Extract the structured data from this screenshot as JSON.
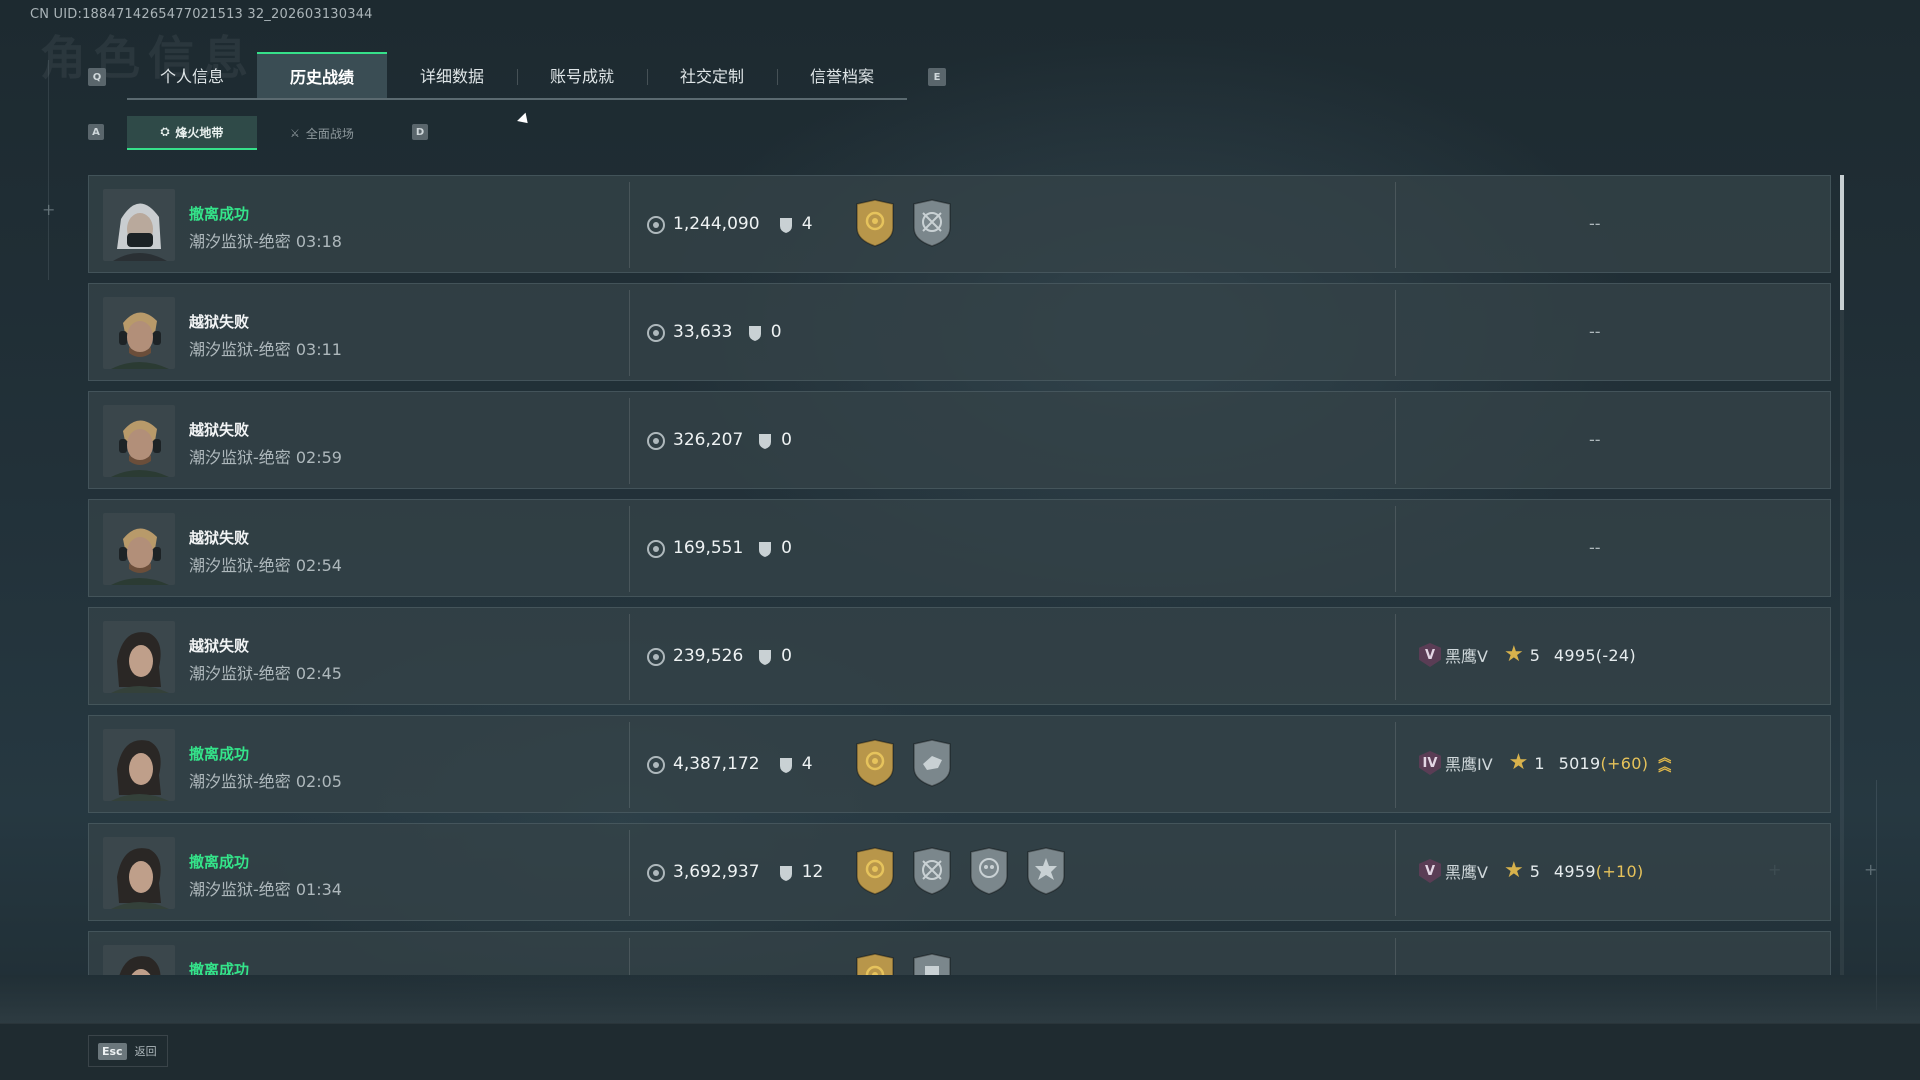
{
  "uid": "CN UID:1884714265477021513 32_202603130344",
  "ghost_title": "角色信息",
  "tabs": {
    "left_key": "Q",
    "right_key": "E",
    "items": [
      {
        "label": "个人信息"
      },
      {
        "label": "历史战绩"
      },
      {
        "label": "详细数据"
      },
      {
        "label": "账号成就"
      },
      {
        "label": "社交定制"
      },
      {
        "label": "信誉档案"
      }
    ],
    "active_index": 1
  },
  "subtabs": {
    "left_key": "A",
    "right_key": "D",
    "items": [
      {
        "label": "烽火地带",
        "icon": "zone-icon"
      },
      {
        "label": "全面战场",
        "icon": "battlefield-icon"
      }
    ],
    "active_index": 0
  },
  "records": [
    {
      "result": "撤离成功",
      "status": "success",
      "avatar": "masked-operator",
      "map": "潮汐监狱-绝密 03:18",
      "value": "1,244,090",
      "kills": "4",
      "badges": [
        "gold-crosshair-badge",
        "silver-aim-badge"
      ],
      "rank": null,
      "dash": "--"
    },
    {
      "result": "越狱失败",
      "status": "fail",
      "avatar": "headset-operator",
      "map": "潮汐监狱-绝密 03:11",
      "value": "33,633",
      "kills": "0",
      "badges": [],
      "rank": null,
      "dash": "--"
    },
    {
      "result": "越狱失败",
      "status": "fail",
      "avatar": "headset-operator",
      "map": "潮汐监狱-绝密 02:59",
      "value": "326,207",
      "kills": "0",
      "badges": [],
      "rank": null,
      "dash": "--"
    },
    {
      "result": "越狱失败",
      "status": "fail",
      "avatar": "headset-operator",
      "map": "潮汐监狱-绝密 02:54",
      "value": "169,551",
      "kills": "0",
      "badges": [],
      "rank": null,
      "dash": "--"
    },
    {
      "result": "越狱失败",
      "status": "fail",
      "avatar": "female-operator",
      "map": "潮汐监狱-绝密 02:45",
      "value": "239,526",
      "kills": "0",
      "badges": [],
      "rank": {
        "tier": "V",
        "name": "黑鹰V",
        "stars": "5",
        "score": "4995",
        "delta": "(-24)",
        "delta_sign": "neg",
        "promo": false
      }
    },
    {
      "result": "撤离成功",
      "status": "success",
      "avatar": "female-operator",
      "map": "潮汐监狱-绝密 02:05",
      "value": "4,387,172",
      "kills": "4",
      "badges": [
        "gold-crosshair-badge",
        "silver-hand-badge"
      ],
      "rank": {
        "tier": "IV",
        "name": "黑鹰IV",
        "stars": "1",
        "score": "5019",
        "delta": "(+60)",
        "delta_sign": "pos",
        "promo": true
      }
    },
    {
      "result": "撤离成功",
      "status": "success",
      "avatar": "female-operator",
      "map": "潮汐监狱-绝密 01:34",
      "value": "3,692,937",
      "kills": "12",
      "badges": [
        "gold-crosshair-badge",
        "silver-aim-badge",
        "silver-skull-badge",
        "silver-burst-badge"
      ],
      "rank": {
        "tier": "V",
        "name": "黑鹰V",
        "stars": "5",
        "score": "4959",
        "delta": "(+10)",
        "delta_sign": "pos",
        "promo": false
      }
    },
    {
      "result": "撤离成功",
      "status": "success",
      "avatar": "female-operator",
      "map": "",
      "value": "",
      "kills": "",
      "badges": [
        "gold-crosshair-badge",
        "silver-doc-badge"
      ],
      "rank": null,
      "partial": true
    }
  ],
  "footer": {
    "esc_key": "Esc",
    "esc_label": "返回"
  },
  "colors": {
    "accent_green": "#34e48a",
    "gold": "#d8b24c",
    "row_bg": "#344248"
  }
}
